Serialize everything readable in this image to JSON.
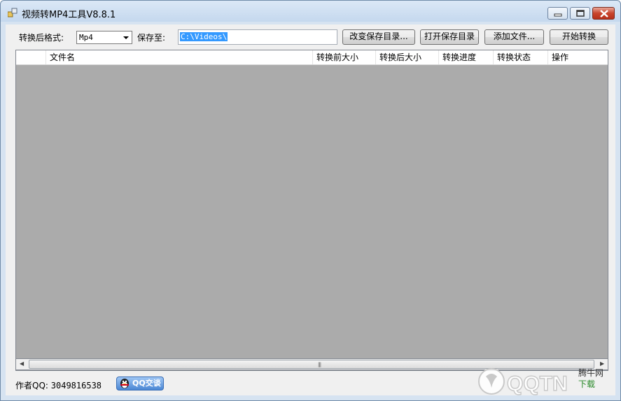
{
  "window": {
    "title": "视频转MP4工具V8.8.1",
    "icon": "app-icon"
  },
  "toolbar": {
    "format_label": "转换后格式:",
    "format_value": "Mp4",
    "save_to_label": "保存至:",
    "save_path": "C:\\Videos\\",
    "change_dir_button": "改变保存目录...",
    "open_dir_button": "打开保存目录",
    "add_file_button": "添加文件...",
    "start_button": "开始转换"
  },
  "grid": {
    "columns": [
      "",
      "文件名",
      "转换前大小",
      "转换后大小",
      "转换进度",
      "转换状态",
      "操作"
    ],
    "rows": []
  },
  "footer": {
    "author_label": "作者QQ:",
    "author_qq": "3049816538",
    "qq_button": "QQ交谈"
  },
  "watermark": {
    "logo_text": "QQTN",
    "site_name": "腾牛网",
    "site_suffix": "下载"
  },
  "colors": {
    "grid_background": "#ababab",
    "selection": "#3399ff",
    "close_button": "#c8442c"
  }
}
